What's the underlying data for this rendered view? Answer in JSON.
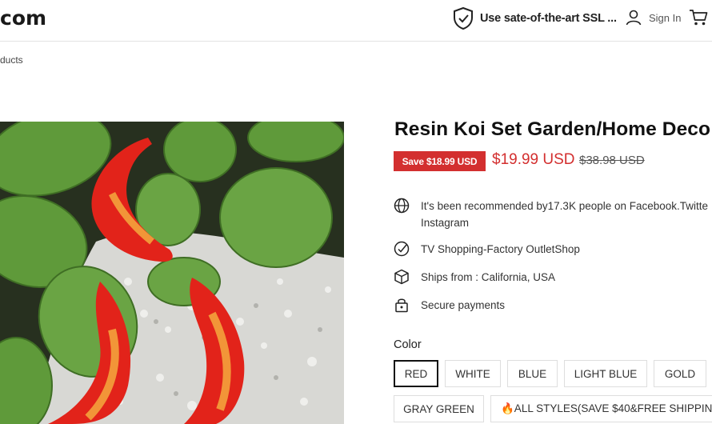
{
  "header": {
    "logo": "com",
    "ssl_text": "Use sate-of-the-art SSL ...",
    "signin_label": "Sign In",
    "icons": {
      "ssl": "shield-check-icon",
      "user": "user-icon",
      "cart": "cart-icon"
    }
  },
  "breadcrumb": "ducts",
  "product": {
    "title": "Resin Koi Set Garden/Home Deco",
    "save_badge": "Save $18.99 USD",
    "price": "$19.99 USD",
    "compare_price": "$38.98 USD",
    "features": [
      {
        "icon": "globe-icon",
        "line1": "It's been recommended by17.3K people on Facebook.Twitte",
        "line2": "Instagram"
      },
      {
        "icon": "check-circle-icon",
        "line1": "TV Shopping-Factory OutletShop"
      },
      {
        "icon": "box-icon",
        "line1": "Ships from : California, USA"
      },
      {
        "icon": "lock-icon",
        "line1": "Secure payments"
      }
    ],
    "color_label": "Color",
    "color_options": [
      "RED",
      "WHITE",
      "BLUE",
      "LIGHT BLUE",
      "GOLD",
      "GRAY GREEN",
      "🔥ALL STYLES(SAVE $40&FREE SHIPPIN"
    ],
    "selected_color": "RED"
  },
  "colors": {
    "accent": "#d32f2f",
    "text": "#222222",
    "border": "#dedede"
  }
}
